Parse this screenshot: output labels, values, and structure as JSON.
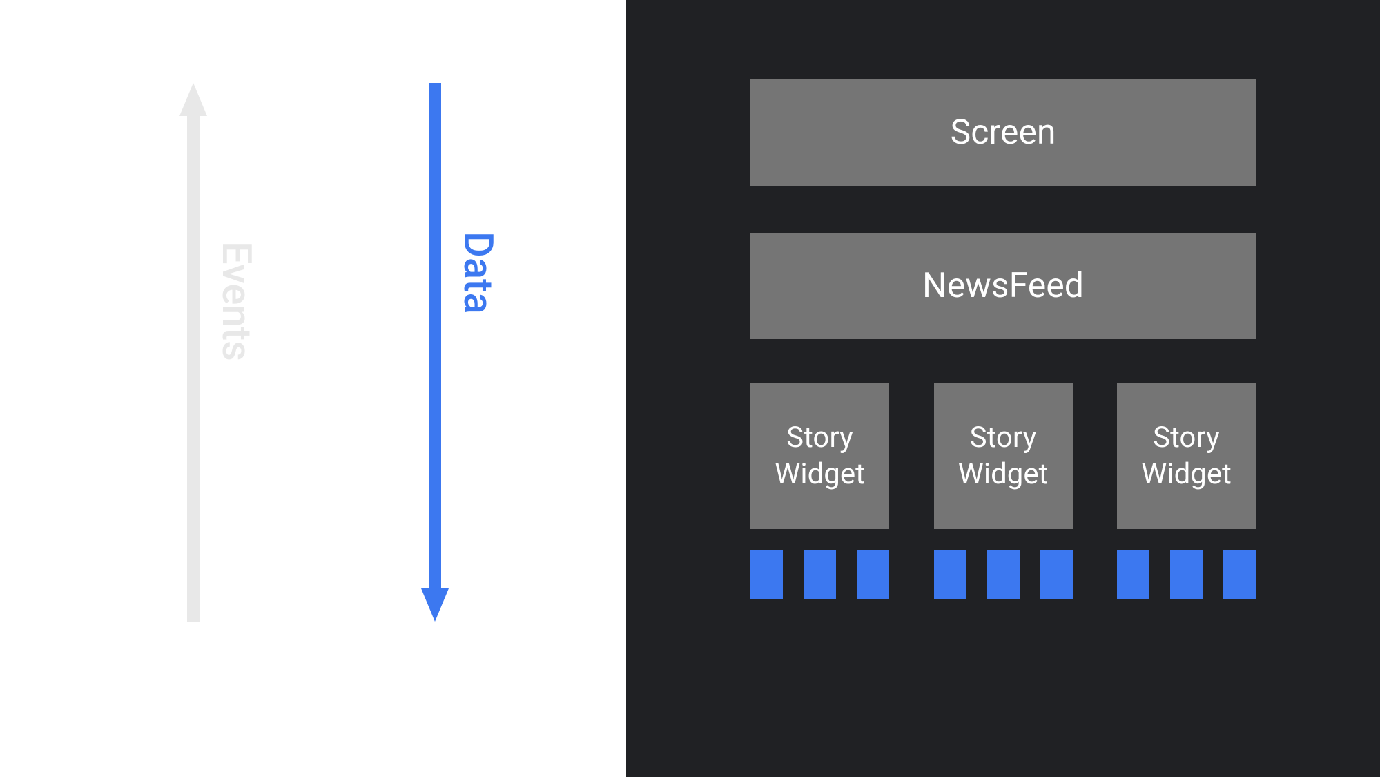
{
  "arrows": {
    "events_label": "Events",
    "data_label": "Data",
    "events_color": "#e8e8e8",
    "data_color": "#3c78f0"
  },
  "hierarchy": {
    "screen_label": "Screen",
    "newsfeed_label": "NewsFeed",
    "widgets": [
      {
        "line1": "Story",
        "line2": "Widget"
      },
      {
        "line1": "Story",
        "line2": "Widget"
      },
      {
        "line1": "Story",
        "line2": "Widget"
      }
    ],
    "chips_per_widget": 3
  },
  "colors": {
    "background_dark": "#202124",
    "box_gray": "#757575",
    "accent_blue": "#3c78f0",
    "faded_gray": "#e8e8e8"
  }
}
